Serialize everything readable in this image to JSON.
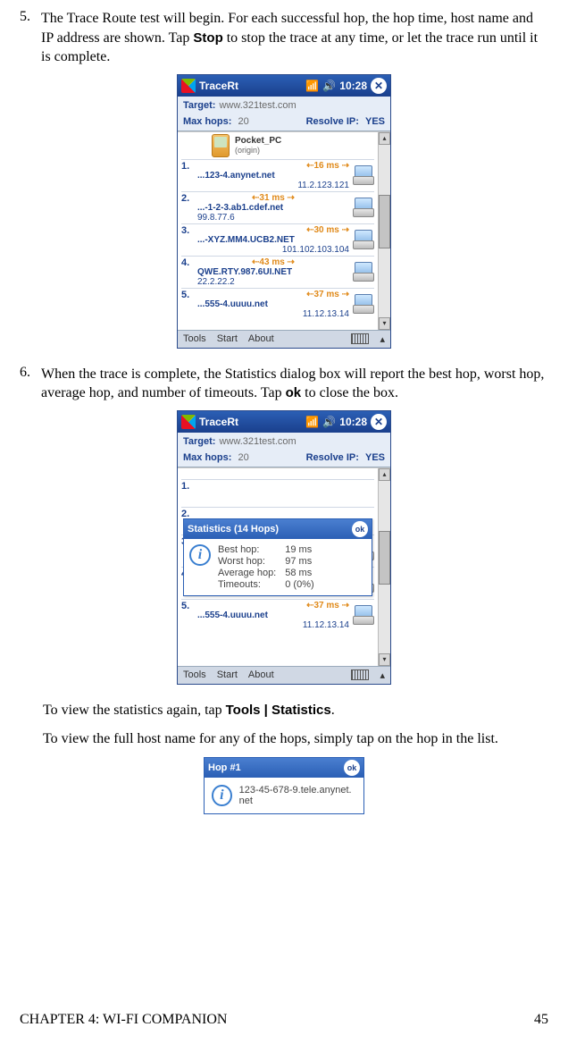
{
  "step5": {
    "num": "5.",
    "text_a": "The Trace Route test will begin. For each successful hop, the hop time, host name and IP address are shown. Tap ",
    "stop": "Stop",
    "text_b": " to stop the trace at any time, or let the trace run until it is complete."
  },
  "step6": {
    "num": "6.",
    "text_a": "When the trace is complete, the Statistics dialog box will report the best hop, worst hop, average hop, and number of timeouts. Tap ",
    "ok": "ok",
    "text_b": " to close the box."
  },
  "para_stats": {
    "a": "To view the statistics again, tap ",
    "menu": "Tools | Statistics",
    "b": "."
  },
  "para_host": "To view the full host name for any of the hops, simply tap on the hop in the list.",
  "ppc_common": {
    "title": "TraceRt",
    "time": "10:28",
    "target_lbl": "Target:",
    "target_val": "www.321test.com",
    "maxhops_lbl": "Max hops:",
    "maxhops_val": "20",
    "resolve_lbl": "Resolve IP:",
    "resolve_val": "YES",
    "menu_tools": "Tools",
    "menu_start": "Start",
    "menu_about": "About"
  },
  "origin": {
    "name": "Pocket_PC",
    "sub": "(origin)"
  },
  "hops": [
    {
      "n": "1.",
      "time": "16 ms",
      "host": "...123-4.anynet.net",
      "ip": "11.2.123.121"
    },
    {
      "n": "2.",
      "time": "31 ms",
      "host": "...-1-2-3.ab1.cdef.net",
      "ip": "99.8.77.6"
    },
    {
      "n": "3.",
      "time": "30 ms",
      "host": "...-XYZ.MM4.UCB2.NET",
      "ip": "101.102.103.104"
    },
    {
      "n": "4.",
      "time": "43 ms",
      "host": "QWE.RTY.987.6UI.NET",
      "ip": "22.2.22.2"
    },
    {
      "n": "5.",
      "time": "37 ms",
      "host": "...555-4.uuuu.net",
      "ip": "11.12.13.14"
    }
  ],
  "stats": {
    "title": "Statistics (14 Hops)",
    "rows": [
      {
        "k": "Best hop:",
        "v": "19 ms"
      },
      {
        "k": "Worst hop:",
        "v": "97 ms"
      },
      {
        "k": "Average hop:",
        "v": "58 ms"
      },
      {
        "k": "Timeouts:",
        "v": "0 (0%)"
      }
    ]
  },
  "hop_dialog": {
    "title": "Hop #1",
    "host": "123-45-678-9.tele.anynet.net"
  },
  "footer": {
    "chapter": "CHAPTER 4: WI-FI COMPANION",
    "page": "45"
  }
}
